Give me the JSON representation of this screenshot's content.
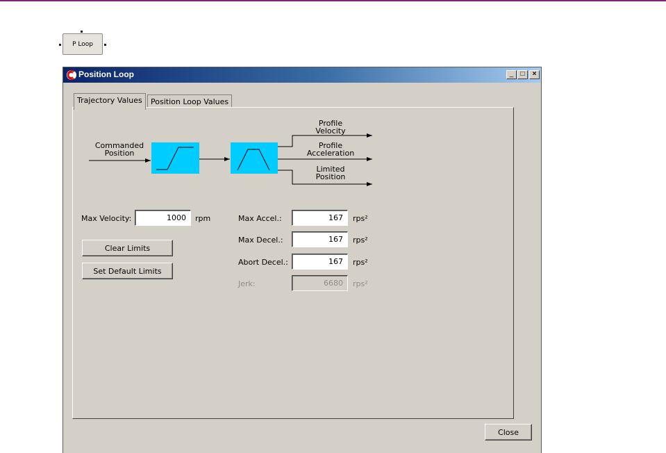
{
  "ploop_button": {
    "label": "P Loop"
  },
  "window": {
    "title": "Position Loop",
    "minimize": "_",
    "maximize": "□",
    "close": "×"
  },
  "tabs": [
    {
      "label": "Trajectory Values",
      "active": true
    },
    {
      "label": "Position Loop Values",
      "active": false
    }
  ],
  "diagram": {
    "input_label": [
      "Commanded",
      "Position"
    ],
    "outputs": [
      {
        "label": [
          "Profile",
          "Velocity"
        ]
      },
      {
        "label": [
          "Profile",
          "Acceleration"
        ]
      },
      {
        "label": [
          "Limited",
          "Position"
        ]
      }
    ],
    "block_color": "#00ccff"
  },
  "fields": {
    "max_velocity": {
      "label": "Max Velocity:",
      "value": "1000",
      "unit": "rpm"
    },
    "max_accel": {
      "label": "Max Accel.:",
      "value": "167",
      "unit": "rps²"
    },
    "max_decel": {
      "label": "Max Decel.:",
      "value": "167",
      "unit": "rps²"
    },
    "abort_decel": {
      "label": "Abort Decel.:",
      "value": "167",
      "unit": "rps²"
    },
    "jerk": {
      "label": "Jerk:",
      "value": "6680",
      "unit": "rps²",
      "disabled": true
    }
  },
  "buttons": {
    "clear_limits": "Clear Limits",
    "set_default_limits": "Set Default Limits",
    "close": "Close"
  }
}
